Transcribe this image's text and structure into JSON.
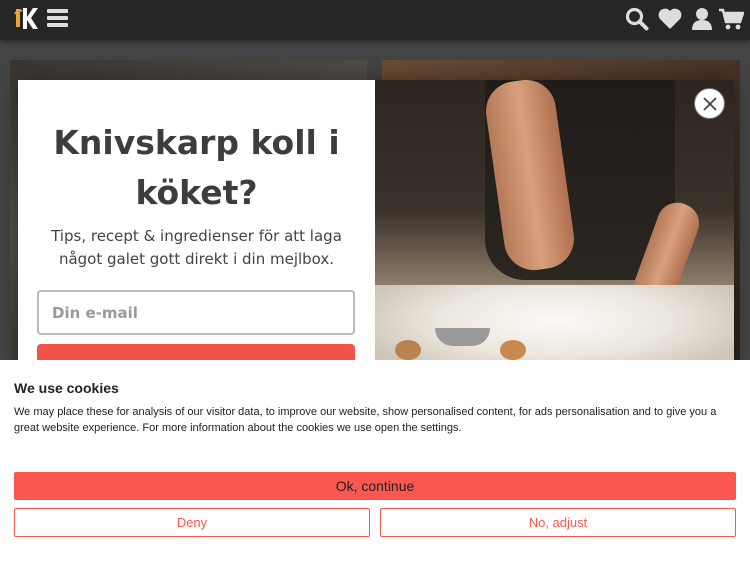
{
  "header": {
    "logo_icon": "kniv-logo-icon",
    "menu_icon": "hamburger-menu-icon",
    "icons": [
      "search-icon",
      "heart-icon",
      "user-icon",
      "cart-icon"
    ]
  },
  "popup": {
    "title": "Knivskarp koll i köket?",
    "subtitle": "Tips, recept & ingredienser för att laga något galet gott direkt i din mejlbox.",
    "email_placeholder": "Din e-mail",
    "close_icon": "close-icon",
    "accent_color": "#f0534a"
  },
  "cookie_banner": {
    "title": "We use cookies",
    "text": "We may place these for analysis of our visitor data, to improve our website, show personalised content, for ads personalisation and to give you a great website experience. For more information about the cookies we use open the settings.",
    "ok_label": "Ok, continue",
    "deny_label": "Deny",
    "adjust_label": "No, adjust",
    "accent_color": "#f9574f"
  }
}
